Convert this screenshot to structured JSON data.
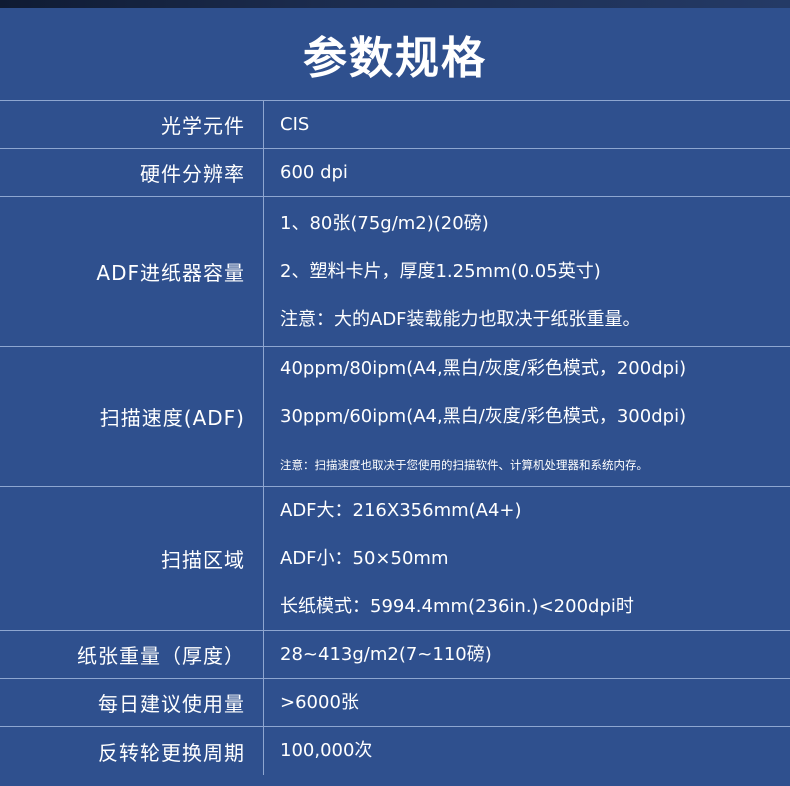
{
  "title": "参数规格",
  "specs": [
    {
      "label": "光学元件",
      "values": [
        "CIS"
      ]
    },
    {
      "label": "硬件分辨率",
      "values": [
        "600 dpi"
      ]
    },
    {
      "label": "ADF进纸器容量",
      "values": [
        "1、80张(75g/m2)(20磅)",
        "2、塑料卡片，厚度1.25mm(0.05英寸)",
        "注意：大的ADF装载能力也取决于纸张重量。"
      ]
    },
    {
      "label": "扫描速度(ADF)",
      "values": [
        "40ppm/80ipm(A4,黑白/灰度/彩色模式，200dpi)",
        "30ppm/60ipm(A4,黑白/灰度/彩色模式，300dpi)",
        "注意：扫描速度也取决于您使用的扫描软件、计算机处理器和系统内存。"
      ]
    },
    {
      "label": "扫描区域",
      "values": [
        "ADF大：216X356mm(A4+)",
        "ADF小：50×50mm",
        "长纸模式：5994.4mm(236in.)<200dpi时"
      ]
    },
    {
      "label": "纸张重量（厚度）",
      "values": [
        "28~413g/m2(7~110磅)"
      ]
    },
    {
      "label": "每日建议使用量",
      "values": [
        ">6000张"
      ]
    },
    {
      "label": "反转轮更换周期",
      "values": [
        "100,000次"
      ]
    }
  ]
}
